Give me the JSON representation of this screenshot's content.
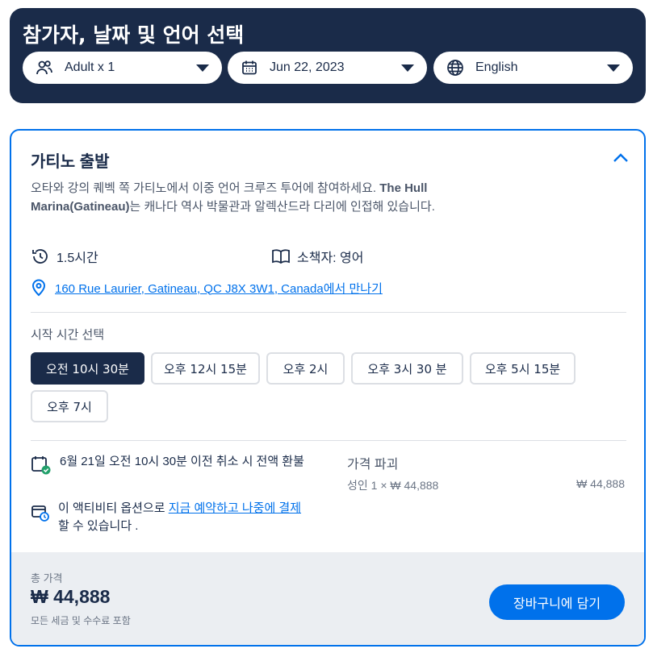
{
  "header": {
    "title": "참가자, 날짜 및 언어 선택",
    "travelers": "Adult x 1",
    "date": "Jun 22, 2023",
    "language": "English"
  },
  "option": {
    "title": "가티노 출발",
    "description_1": "오타와 강의 퀘벡 쪽 가티노에서 이중 언어 크루즈 투어에 참여하세요. ",
    "description_bold": "The Hull Marina(Gatineau)",
    "description_2": "는 캐나다 역사 박물관과 알렉산드라 다리에 인접해 있습니다.",
    "duration": "1.5시간",
    "booklet": "소책자: 영어",
    "meeting_address": "160 Rue Laurier, Gatineau, QC J8X 3W1, Canada",
    "meeting_suffix": "에서 만나기"
  },
  "times": {
    "label": "시작 시간 선택",
    "slots": [
      "오전 10시 30분",
      "오후 12시 15분",
      "오후 2시",
      "오후 3시 30 분",
      "오후 5시 15분",
      "오후 7시"
    ],
    "selected_index": 0
  },
  "policy": {
    "cancellation": "6월 21일 오전 10시 30분 이전 취소 시 전액 환불",
    "pay_prefix": "이 액티비티 옵션으로 ",
    "pay_link": "지금 예약하고 나중에 결제",
    "pay_suffix": " 할 수 있습니다 ."
  },
  "price_breakdown": {
    "label": "가격 파괴",
    "line": "성인 1 × ₩ 44,888",
    "amount": "₩ 44,888"
  },
  "footer": {
    "total_label": "총 가격",
    "total_price": "₩ 44,888",
    "note": "모든 세금 및 수수료 포함",
    "cart_button": "장바구니에 담기"
  },
  "colors": {
    "navy": "#1a2b49",
    "accent": "#0071eb",
    "footer_bg": "#ebeef2",
    "success": "#22a06b"
  }
}
